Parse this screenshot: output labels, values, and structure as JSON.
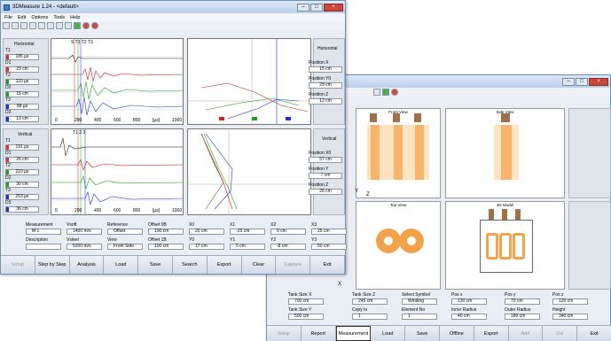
{
  "win1": {
    "title": "3DMeasure 1.24 - <default>",
    "menu": [
      "File",
      "Edit",
      "Options",
      "Tools",
      "Help"
    ],
    "h_side": {
      "title": "Horizontal",
      "channels": [
        {
          "name": "T1",
          "val": "185 µs",
          "color": "#e03030"
        },
        {
          "name": "D1",
          "val": "23 cm",
          "color": "#e03030"
        },
        {
          "name": "T2",
          "val": "110 µs",
          "color": "#20a020"
        },
        {
          "name": "D2",
          "val": "15 cm",
          "color": "#20a020"
        },
        {
          "name": "T3",
          "val": "88 µs",
          "color": "#2030d0"
        },
        {
          "name": "D3",
          "val": "13 cm",
          "color": "#2030d0"
        }
      ]
    },
    "v_side": {
      "title": "Vertical",
      "channels": [
        {
          "name": "T1",
          "val": "191 µs",
          "color": "#e03030"
        },
        {
          "name": "D1",
          "val": "26 cm",
          "color": "#e03030"
        },
        {
          "name": "T2",
          "val": "210 µs",
          "color": "#20a020"
        },
        {
          "name": "D2",
          "val": "30 cm",
          "color": "#20a020"
        },
        {
          "name": "T3",
          "val": "253 µs",
          "color": "#2030d0"
        },
        {
          "name": "D3",
          "val": "36 cm",
          "color": "#2030d0"
        }
      ]
    },
    "h_ticks": [
      "0",
      "200",
      "400",
      "600",
      "800",
      "[µs]",
      "1000"
    ],
    "h_markers": "S T1 T2 T3",
    "v_ticks": [
      "0",
      "200",
      "400",
      "600",
      "800",
      "[µs]",
      "1000"
    ],
    "v_markers": "T1 2 3",
    "h_right_ticks_x": [
      "-40",
      "-20",
      "0",
      "20",
      "40"
    ],
    "h_right_ticks_y": [
      "50",
      "40",
      "30",
      "20",
      "10",
      "0"
    ],
    "v_right_ticks_x": [
      "0",
      "30",
      "60",
      "90",
      "120"
    ],
    "v_right_ticks_y": [
      "100",
      "80",
      "60",
      "40",
      "20",
      "0"
    ],
    "h_pos": {
      "title": "Horizontal",
      "items": [
        {
          "label": "Position X",
          "val": "15 cm"
        },
        {
          "label": "Position Y0",
          "val": "29 cm"
        },
        {
          "label": "Position Z",
          "val": "12 cm"
        }
      ]
    },
    "v_pos": {
      "title": "Vertical",
      "items": [
        {
          "label": "Position X0",
          "val": "57 cm"
        },
        {
          "label": "Position Y",
          "val": "7 cm"
        },
        {
          "label": "Position Z",
          "val": "26 cm"
        }
      ]
    },
    "fields": [
      {
        "label": "Measurement",
        "val": "M 1"
      },
      {
        "label": "Vsoft",
        "val": "1400 m/s"
      },
      {
        "label": "Reference",
        "val": "Offset"
      },
      {
        "label": "Offset 0B",
        "val": "100 cm"
      },
      {
        "label": "X0",
        "val": "20 cm"
      },
      {
        "label": "X1",
        "val": "-25 cm"
      },
      {
        "label": "X2",
        "val": "0 cm"
      },
      {
        "label": "X3",
        "val": "25 cm"
      },
      {
        "label": "Description",
        "val": ""
      },
      {
        "label": "Vsteel",
        "val": "5200 m/s"
      },
      {
        "label": "View",
        "val": "Front Side"
      },
      {
        "label": "Offset 1B",
        "val": "100 cm"
      },
      {
        "label": "Y0",
        "val": "17 cm"
      },
      {
        "label": "Y1",
        "val": "5 cm"
      },
      {
        "label": "Y2",
        "val": "-8 cm"
      },
      {
        "label": "Y3",
        "val": "50 cm"
      }
    ],
    "buttons": [
      {
        "l": "Setup",
        "d": true
      },
      {
        "l": "Step by Step"
      },
      {
        "l": "Analysis"
      },
      {
        "l": "Load"
      },
      {
        "l": "Save"
      },
      {
        "l": "Search"
      },
      {
        "l": "Export"
      },
      {
        "l": "Clear"
      },
      {
        "l": "Capture",
        "d": true
      },
      {
        "l": "Exit"
      }
    ]
  },
  "win2": {
    "views": [
      "Front View",
      "Side View",
      "Top View",
      "3D Model"
    ],
    "fields": [
      {
        "label": "Tank Size X",
        "val": "700 cm"
      },
      {
        "label": "Tank Size Z",
        "val": "245 cm"
      },
      {
        "label": "Select Symbol",
        "val": "Winding"
      },
      {
        "label": "Pos x",
        "val": "130 cm"
      },
      {
        "label": "Pos y",
        "val": "70 cm"
      },
      {
        "label": "Pos z",
        "val": "120 cm"
      },
      {
        "label": "Tank Size Y",
        "val": "500 cm"
      },
      {
        "label": "Copy to",
        "val": "1"
      },
      {
        "label": "Element No",
        "val": "1"
      },
      {
        "label": "Inner Radius",
        "val": "40 cm"
      },
      {
        "label": "Outer Radius",
        "val": "180 cm"
      },
      {
        "label": "Height",
        "val": "340 cm"
      }
    ],
    "buttons": [
      {
        "l": "Setup",
        "d": true
      },
      {
        "l": "Report"
      },
      {
        "l": "Measurement",
        "a": true
      },
      {
        "l": "Load"
      },
      {
        "l": "Save"
      },
      {
        "l": "Offline"
      },
      {
        "l": "Export"
      },
      {
        "l": "Add",
        "d": true
      },
      {
        "l": "Del",
        "d": true
      },
      {
        "l": "Exit"
      }
    ],
    "axis": {
      "y": "Y",
      "z": "Z",
      "x": "X"
    }
  }
}
